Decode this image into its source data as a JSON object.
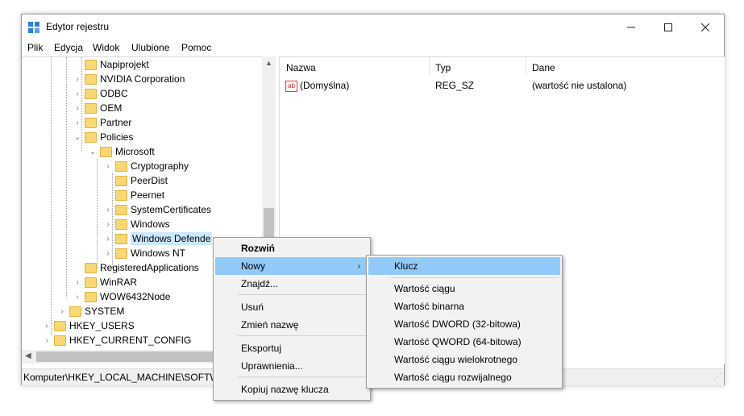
{
  "window": {
    "title": "Edytor rejestru"
  },
  "menu": [
    "Plik",
    "Edycja",
    "Widok",
    "Ulubione",
    "Pomoc"
  ],
  "tree": {
    "items": [
      {
        "label": "Napiprojekt"
      },
      {
        "label": "NVIDIA Corporation"
      },
      {
        "label": "ODBC"
      },
      {
        "label": "OEM"
      },
      {
        "label": "Partner"
      },
      {
        "label": "Policies"
      },
      {
        "label": "Microsoft"
      },
      {
        "label": "Cryptography"
      },
      {
        "label": "PeerDist"
      },
      {
        "label": "Peernet"
      },
      {
        "label": "SystemCertificates"
      },
      {
        "label": "Windows"
      },
      {
        "label": "Windows Defende"
      },
      {
        "label": "Windows NT"
      },
      {
        "label": "RegisteredApplications"
      },
      {
        "label": "WinRAR"
      },
      {
        "label": "WOW6432Node"
      },
      {
        "label": "SYSTEM"
      },
      {
        "label": "HKEY_USERS"
      },
      {
        "label": "HKEY_CURRENT_CONFIG"
      }
    ]
  },
  "values": {
    "columns": {
      "name": "Nazwa",
      "type": "Typ",
      "data": "Dane"
    },
    "rows": [
      {
        "name": "(Domyślna)",
        "type": "REG_SZ",
        "data": "(wartość nie ustalona)"
      }
    ]
  },
  "status": "Komputer\\HKEY_LOCAL_MACHINE\\SOFTWA",
  "context_menu": {
    "items": [
      "Rozwiń",
      "Nowy",
      "Znajdź...",
      "Usuń",
      "Zmień nazwę",
      "Eksportuj",
      "Uprawnienia...",
      "Kopiuj nazwę klucza"
    ]
  },
  "submenu": {
    "items": [
      "Klucz",
      "Wartość ciągu",
      "Wartość binarna",
      "Wartość DWORD (32-bitowa)",
      "Wartość QWORD (64-bitowa)",
      "Wartość ciągu wielokrotnego",
      "Wartość ciągu rozwijalnego"
    ]
  },
  "colors": {
    "folder": "#f8d775",
    "highlight": "#91c9f7",
    "selection": "#cce8ff"
  }
}
